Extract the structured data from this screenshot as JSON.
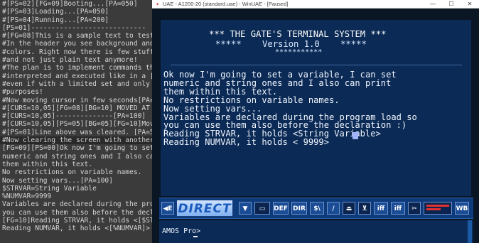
{
  "editor": {
    "lines": [
      "#[PS=02][FG=09]Booting...[PA=050]",
      "#[PS=03]Loading...[PA=050]",
      "#[PS=04]Running...[PA=200]",
      "[PS=01]----------------------------",
      "#[FG=08]This is a sample text to test",
      "#In the header you see background and",
      "#colors. Right now there is few stuff",
      "#and not just plain text anymore!",
      "#The plan is to implement commands th",
      "#interpreted and executed like in a [",
      "#even if with a limited set and only ",
      "#purposes!",
      "#Now moving cursor in few seconds[PA=",
      "#[CURS=10,05][FG=08][BG=10] MOVED AT ",
      "#[CURS=10,05]--------------[PA=100]",
      "#[CURS=10,05][PS=05][BG=05][FG=10]Mov",
      "#[PS=01]Line above was cleared. [PA=5",
      "#Now clearing the screen with another",
      "[FG=09][PS=00]Ok now I'm going to set",
      "numeric and string ones and I also ca",
      "them within this text.",
      "No restrictions on variable names.",
      "Now setting vars...[PA=100]",
      "$STRVAR=String Variable",
      "%NUMVAR=9999",
      "Variables are declared during the pro",
      "you can use them also before the decl",
      "[FG=10]Reading STRVAR, it holds <[$ST",
      "Reading NUMVAR, it holds <[%NUMVAR]>"
    ]
  },
  "window": {
    "title": "UAE - A1200-20 (standard.uae) - WinUAE - [Paused]",
    "minimize": "—",
    "maximize": "☐",
    "close": "✕"
  },
  "amiga": {
    "header_line1": "*** THE GATE'S TERMINAL SYSTEM ***",
    "header_line2": "*****    Version 1.0    *****",
    "header_line3": "***********",
    "body": "Ok now I'm going to set a variable, I can set\nnumeric and string ones and I also can print\nthem within this text.\nNo restrictions on variable names.\nNow setting vars...\nVariables are declared during the program load so\nyou can use them also before the declaration :)\nReading STRVAR, it holds <String Variable>\nReading NUMVAR, it holds < 9999>"
  },
  "toolbar": {
    "edit_label": "E",
    "direct_logo": "DIRECT",
    "def_label": "DEF",
    "dir_label": "DIR",
    "shift_label": "$\\",
    "iff_label1": "iff",
    "iff_label2": "iff",
    "wb_label": "WB",
    "cmd_prompt": "AMOS Pro>"
  }
}
